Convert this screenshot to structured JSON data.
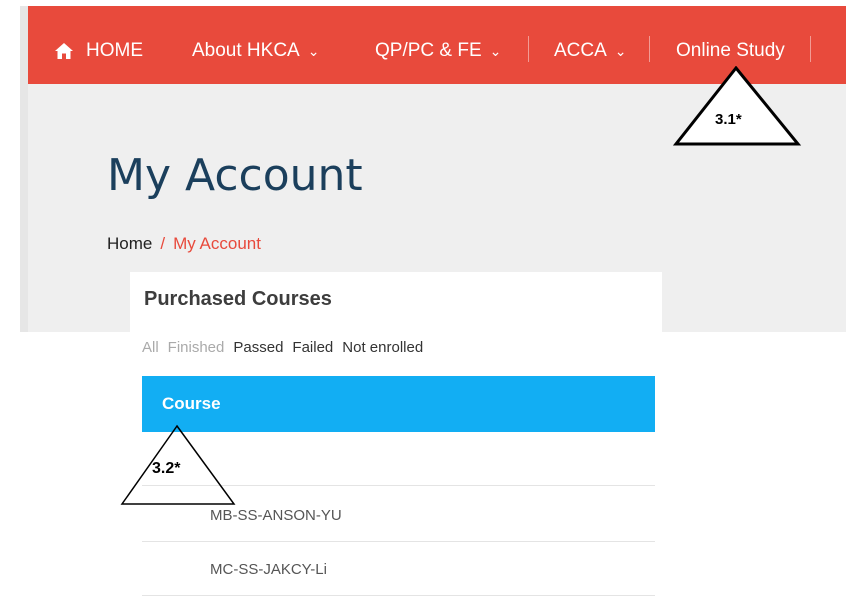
{
  "nav": {
    "home": "HOME",
    "items": [
      {
        "label": "About HKCA",
        "chevron": "⌄"
      },
      {
        "label": "QP/PC & FE",
        "chevron": "⌄"
      },
      {
        "label": "ACCA",
        "chevron": "⌄"
      },
      {
        "label": "Online Study"
      }
    ],
    "background": "#e84a3c"
  },
  "page": {
    "title": "My Account",
    "breadcrumb": {
      "home": "Home",
      "separator": "/",
      "current": "My Account"
    }
  },
  "courses": {
    "heading": "Purchased Courses",
    "filters": [
      "All",
      "Finished",
      "Passed",
      "Failed",
      "Not enrolled"
    ],
    "column_header": "Course",
    "rows": [
      "MB-SS-ANSON-YU",
      "MC-SS-JAKCY-Li"
    ],
    "header_color": "#12aef3"
  },
  "annotations": {
    "first": "3.1*",
    "second": "3.2*"
  }
}
